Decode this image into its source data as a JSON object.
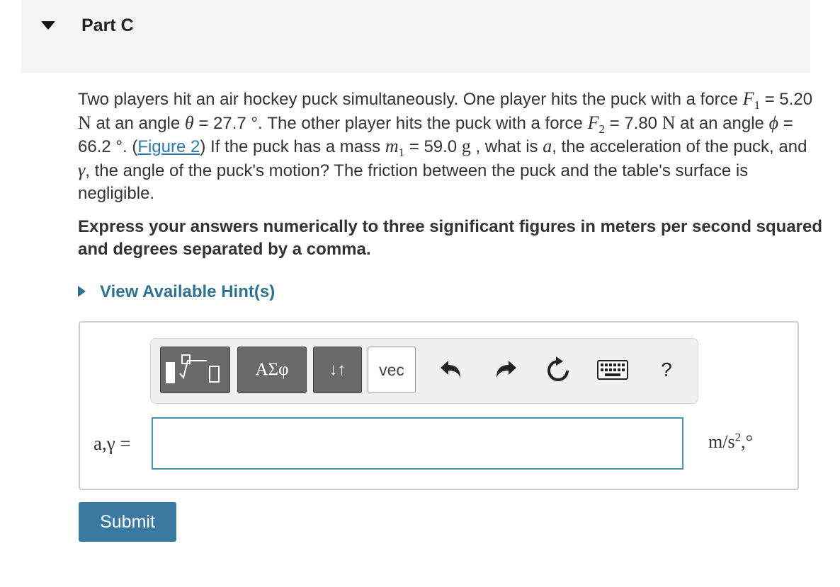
{
  "part": {
    "title": "Part C"
  },
  "question": {
    "t1": "Two players hit an air hockey puck simultaneously. One player hits the puck with a force ",
    "F": "F",
    "sub1": "1",
    "t2": " = 5.20 ",
    "N": "N",
    "t3": " at an angle ",
    "theta": "θ",
    "t4": " = 27.7 °. The other player hits the puck with a force ",
    "sub2": "2",
    "t5": " = 7.80 ",
    "t6": " at an angle ",
    "phi": "ϕ",
    "t7": " = 66.2 °. (",
    "link": "Figure 2",
    "t8": ") If the puck has a mass ",
    "m": "m",
    "t9": " = 59.0 ",
    "g": "g",
    "t10": " , what is ",
    "a": "a",
    "t11": ", the acceleration of the puck, and ",
    "gamma": "γ",
    "t12": ", the angle of the puck's motion? The friction between the puck and the table's surface is negligible."
  },
  "instructions": "Express your answers numerically to three significant figures in meters per second squared and degrees separated by a comma.",
  "hint": {
    "label": "View Available Hint(s)"
  },
  "toolbar": {
    "greek_label": "ΑΣφ",
    "arrows_label": "↓↑",
    "vec_label": "vec",
    "help_label": "?"
  },
  "answer": {
    "label": "a,γ =",
    "value": "",
    "units": "m/s",
    "units_sup": "2",
    "units_tail": ",°"
  },
  "submit": {
    "label": "Submit"
  }
}
